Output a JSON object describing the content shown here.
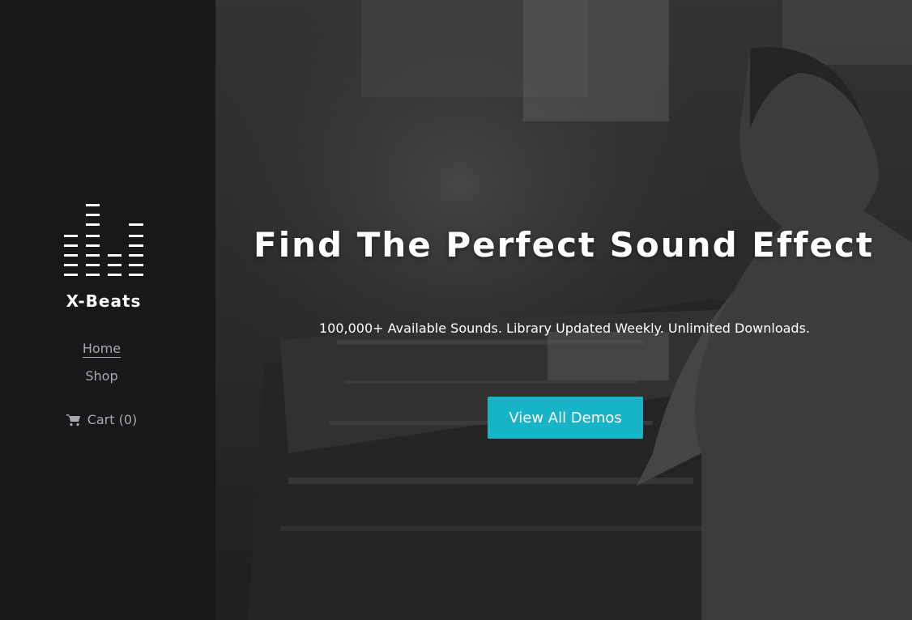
{
  "brand": {
    "name": "X-Beats",
    "logo_icon": "equalizer-bars-icon"
  },
  "nav": {
    "home_label": "Home",
    "shop_label": "Shop",
    "cart_label": "Cart (0)",
    "cart_icon": "shopping-cart-icon"
  },
  "hero": {
    "title": "Find The Perfect Sound Effect",
    "subtitle": "100,000+ Available Sounds. Library Updated Weekly. Unlimited Downloads.",
    "cta_label": "View All Demos",
    "background": "grayscale photo of sound engineer at mixing console"
  },
  "colors": {
    "sidebar_bg": "#18181a",
    "accent": "#17b3c6",
    "nav_text": "#a9a9ad"
  }
}
